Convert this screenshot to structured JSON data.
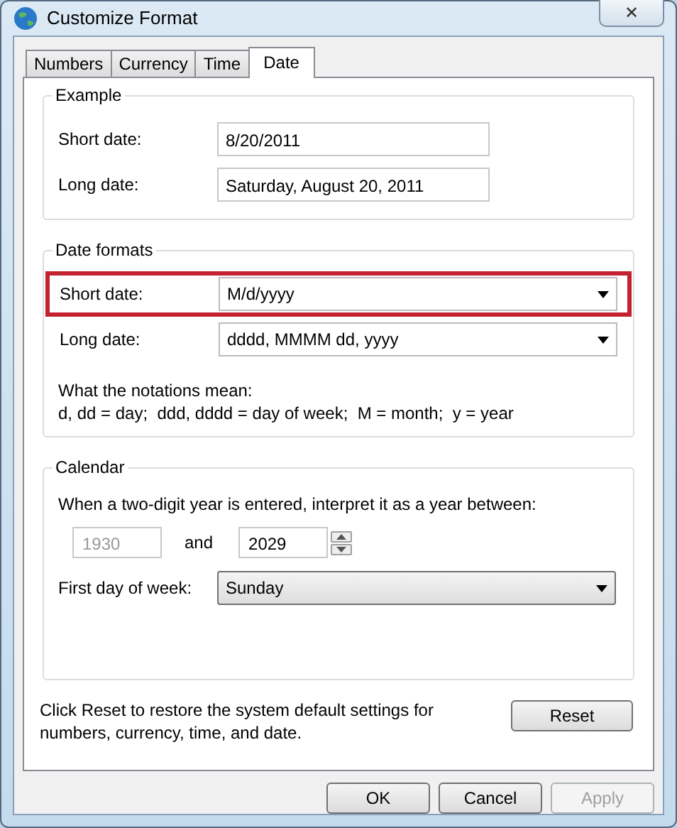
{
  "window": {
    "title": "Customize Format",
    "close": "✕"
  },
  "tabs": [
    {
      "label": "Numbers",
      "selected": false
    },
    {
      "label": "Currency",
      "selected": false
    },
    {
      "label": "Time",
      "selected": false
    },
    {
      "label": "Date",
      "selected": true
    }
  ],
  "example": {
    "title": "Example",
    "rows": [
      {
        "label": "Short date:",
        "value": "8/20/2011"
      },
      {
        "label": "Long date:",
        "value": "Saturday, August 20, 2011"
      }
    ]
  },
  "date_formats": {
    "title": "Date formats",
    "rows": [
      {
        "label": "Short date:",
        "value": "M/d/yyyy",
        "highlighted": true
      },
      {
        "label": "Long date:",
        "value": "dddd, MMMM dd, yyyy",
        "highlighted": false
      }
    ],
    "notes": [
      "What the notations mean:",
      "d, dd = day;  ddd, dddd = day of week;  M = month;  y = year"
    ]
  },
  "calendar": {
    "title": "Calendar",
    "prompt": "When a two-digit year is entered, interpret it as a year between:",
    "year_from": {
      "value": "1930",
      "disabled": true
    },
    "and": "and",
    "year_to": {
      "value": "2029",
      "disabled": false
    },
    "first_day_label": "First day of week:",
    "first_day": "Sunday"
  },
  "reset_note": "Click Reset to restore the system default settings for numbers, currency, time, and date.",
  "reset_button": "Reset",
  "buttons": [
    {
      "label": "OK",
      "disabled": false
    },
    {
      "label": "Cancel",
      "disabled": false
    },
    {
      "label": "Apply",
      "disabled": true
    }
  ]
}
